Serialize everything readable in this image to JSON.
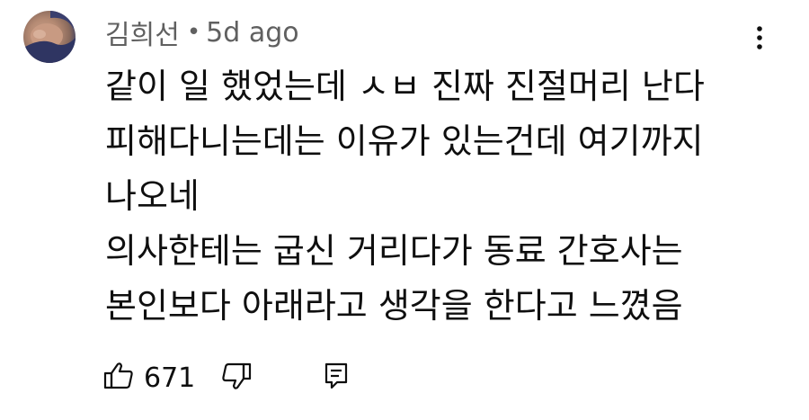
{
  "comment": {
    "author": "김희선",
    "separator": "•",
    "time": "5d ago",
    "lines": [
      "같이 일 했었는데 ㅅㅂ 진짜 진절머리 난다",
      "피해다니는데는 이유가 있는건데 여기까지",
      "나오네",
      "의사한테는 굽신 거리다가 동료 간호사는",
      "본인보다 아래라고 생각을 한다고  느꼈음"
    ],
    "likes": "671"
  },
  "icons": {
    "more": "more-vert-icon",
    "like": "thumb-up-icon",
    "dislike": "thumb-down-icon",
    "reply": "reply-comment-icon"
  },
  "colors": {
    "text": "#0f0f0f",
    "meta": "#606060",
    "background": "#ffffff"
  }
}
